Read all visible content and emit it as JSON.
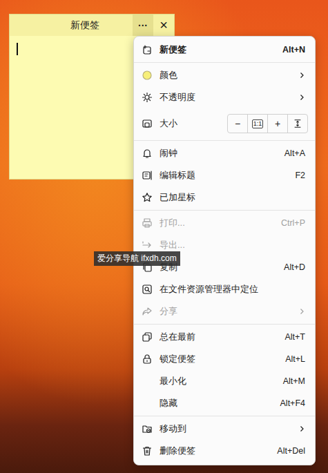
{
  "note": {
    "title": "新便签",
    "more": "···",
    "close": "×"
  },
  "menu": [
    {
      "kind": "item",
      "label": "新便签",
      "shortcut": "Alt+N",
      "default": true,
      "disabled": false,
      "submenu": false
    },
    {
      "kind": "divider"
    },
    {
      "kind": "item",
      "label": "颜色",
      "default": false,
      "disabled": false,
      "submenu": true
    },
    {
      "kind": "item",
      "label": "不透明度",
      "default": false,
      "disabled": false,
      "submenu": true
    },
    {
      "kind": "size",
      "label": "大小",
      "controls": [
        "−",
        "1:1",
        "+"
      ],
      "default": false,
      "disabled": false,
      "submenu": false
    },
    {
      "kind": "divider"
    },
    {
      "kind": "item",
      "label": "闹钟",
      "shortcut": "Alt+A",
      "default": false,
      "disabled": false,
      "submenu": false
    },
    {
      "kind": "item",
      "label": "编辑标题",
      "shortcut": "F2",
      "default": false,
      "disabled": false,
      "submenu": false
    },
    {
      "kind": "item",
      "label": "已加星标",
      "default": false,
      "disabled": false,
      "submenu": false
    },
    {
      "kind": "divider"
    },
    {
      "kind": "item",
      "label": "打印...",
      "shortcut": "Ctrl+P",
      "default": false,
      "disabled": true,
      "submenu": false
    },
    {
      "kind": "item",
      "label": "导出...",
      "default": false,
      "disabled": true,
      "submenu": false
    },
    {
      "kind": "item",
      "label": "复制",
      "shortcut": "Alt+D",
      "default": false,
      "disabled": false,
      "submenu": false
    },
    {
      "kind": "item",
      "label": "在文件资源管理器中定位",
      "default": false,
      "disabled": false,
      "submenu": false
    },
    {
      "kind": "item",
      "label": "分享",
      "default": false,
      "disabled": true,
      "submenu": true
    },
    {
      "kind": "divider"
    },
    {
      "kind": "item",
      "label": "总在最前",
      "shortcut": "Alt+T",
      "default": false,
      "disabled": false,
      "submenu": false
    },
    {
      "kind": "item",
      "label": "锁定便签",
      "shortcut": "Alt+L",
      "default": false,
      "disabled": false,
      "submenu": false
    },
    {
      "kind": "item",
      "label": "最小化",
      "shortcut": "Alt+M",
      "default": false,
      "disabled": false,
      "submenu": false
    },
    {
      "kind": "item",
      "label": "隐藏",
      "shortcut": "Alt+F4",
      "default": false,
      "disabled": false,
      "submenu": false
    },
    {
      "kind": "divider"
    },
    {
      "kind": "item",
      "label": "移动到",
      "default": false,
      "disabled": false,
      "submenu": true
    },
    {
      "kind": "item",
      "label": "删除便签",
      "shortcut": "Alt+Del",
      "default": false,
      "disabled": false,
      "submenu": false
    }
  ],
  "watermark": "爱分享导航 ifxdh.com"
}
